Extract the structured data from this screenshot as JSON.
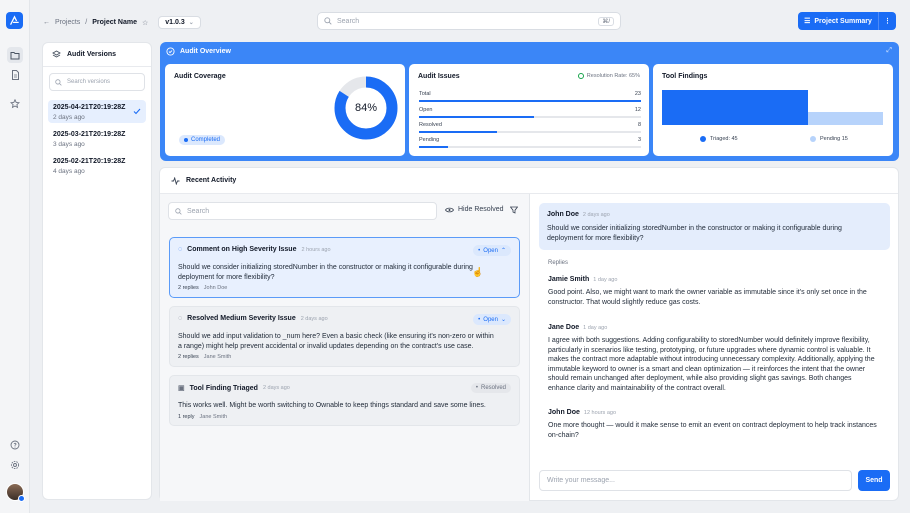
{
  "breadcrumb": {
    "back": "Projects",
    "sep": "/",
    "project": "Project Name",
    "version": "v1.0.3"
  },
  "search": {
    "placeholder": "Search",
    "shortcut": "⌘/"
  },
  "header": {
    "summary_label": "Project Summary"
  },
  "versions": {
    "title": "Audit Versions",
    "search_placeholder": "Search versions",
    "items": [
      {
        "date": "2025-04-21T20:19:28Z",
        "age": "2 days ago",
        "selected": true
      },
      {
        "date": "2025-03-21T20:19:28Z",
        "age": "3 days ago"
      },
      {
        "date": "2025-02-21T20:19:28Z",
        "age": "4 days ago"
      }
    ]
  },
  "overview": {
    "title": "Audit Overview",
    "coverage": {
      "title": "Audit Coverage",
      "percent_label": "84%",
      "percent": 84,
      "status": "Completed"
    },
    "issues": {
      "title": "Audit Issues",
      "resolution": "Resolution Rate: 65%",
      "rows": [
        {
          "label": "Total",
          "value": "23",
          "fill": 1.0
        },
        {
          "label": "Open",
          "value": "12",
          "fill": 0.52
        },
        {
          "label": "Resolved",
          "value": "8",
          "fill": 0.35
        },
        {
          "label": "Pending",
          "value": "3",
          "fill": 0.13
        }
      ]
    },
    "findings": {
      "title": "Tool Findings",
      "triaged_label": "Triaged: 45",
      "pending_label": "Pending 15",
      "triaged": 45,
      "pending": 15
    }
  },
  "activity": {
    "title": "Recent Activity",
    "search_placeholder": "Search",
    "hide_resolved": "Hide Resolved",
    "comments": [
      {
        "title": "Comment on High Severity Issue",
        "time": "2 hours ago",
        "status": "Open",
        "body": "Should we consider initializing storedNumber in the constructor or making it configurable during deployment for more flexibility?",
        "replies": "2 replies",
        "user": "John Doe"
      },
      {
        "title": "Resolved Medium Severity Issue",
        "time": "2 days ago",
        "status": "Open",
        "body": "Should we add input validation to _num here? Even a basic check (like ensuring it's non-zero or within a range) might help prevent accidental or invalid updates depending on the contract's use case.",
        "replies": "2 replies",
        "user": "Jane Smith"
      },
      {
        "title": "Tool Finding Triaged",
        "time": "2 days ago",
        "status": "Resolved",
        "body": "This works well. Might be worth switching to Ownable to keep things standard and save some lines.",
        "replies": "1 reply",
        "user": "Jane Smith"
      }
    ]
  },
  "thread": {
    "original": {
      "author": "John Doe",
      "time": "2 days ago",
      "text": "Should we consider initializing storedNumber in the constructor or making it configurable during deployment for more flexibility?"
    },
    "replies_label": "Replies",
    "replies": [
      {
        "author": "Jamie Smith",
        "time": "1 day ago",
        "text": "Good point. Also, we might want to mark the owner variable as immutable since it's only set once in the constructor. That would slightly reduce gas costs."
      },
      {
        "author": "Jane Doe",
        "time": "1 day ago",
        "text": "I agree with both suggestions. Adding configurability to storedNumber would definitely improve flexibility, particularly in scenarios like testing, prototyping, or future upgrades where dynamic control is valuable. It makes the contract more adaptable without introducing unnecessary complexity. Additionally, applying the immutable keyword to owner is a smart and clean optimization — it reinforces the intent that the owner should remain unchanged after deployment, while also providing slight gas savings. Both changes enhance clarity and maintainability of the contract overall."
      },
      {
        "author": "John Doe",
        "time": "12 hours ago",
        "text": "One more thought — would it make sense to emit an event on contract deployment to help track instances on-chain?"
      }
    ],
    "compose_placeholder": "Write your message...",
    "send_label": "Send"
  },
  "colors": {
    "accent": "#1a6cf5",
    "overview_bg": "#3b86f7",
    "pending": "#b7d3fb"
  }
}
